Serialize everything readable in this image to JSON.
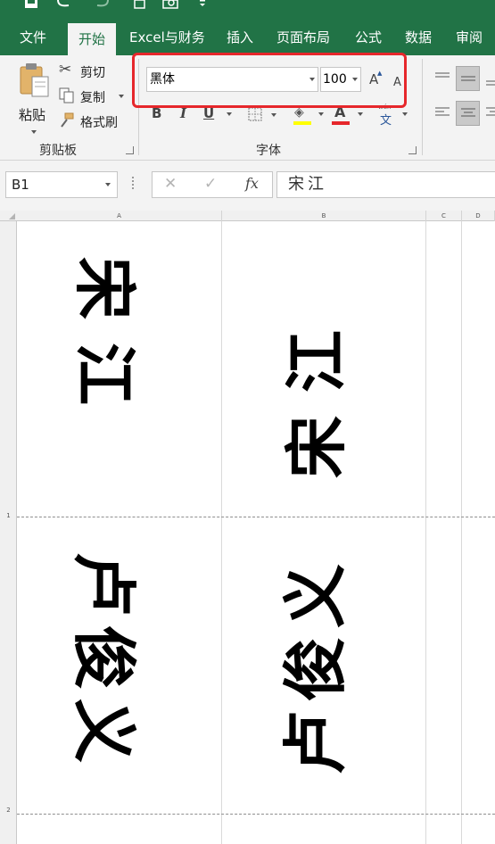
{
  "tabs": [
    "文件",
    "开始",
    "Excel与财务",
    "插入",
    "页面布局",
    "公式",
    "数据",
    "审阅"
  ],
  "active_tab": "开始",
  "clipboard": {
    "paste_label": "粘贴",
    "cut_label": "剪切",
    "copy_label": "复制",
    "format_painter_label": "格式刷",
    "group_label": "剪贴板"
  },
  "font": {
    "name": "黑体",
    "size": "100",
    "group_label": "字体",
    "grow_label": "A",
    "shrink_label": "A",
    "bold_label": "B",
    "italic_label": "I",
    "underline_label": "U",
    "font_color_label": "A",
    "phonetic_label": "文",
    "phonetic_top": "wén",
    "highlight_color": "#ffff00",
    "font_color": "#e6272b",
    "callout_color": "#e6272b"
  },
  "formula_bar": {
    "name_box": "B1",
    "cancel_icon": "✕",
    "enter_icon": "✓",
    "fx_label": "fx",
    "content": "宋江"
  },
  "sheet": {
    "columns": [
      "A",
      "B",
      "C",
      "D"
    ],
    "rows": [
      "1",
      "2"
    ],
    "cells": {
      "A1": "宋江",
      "B1": "宋江",
      "A2": "卢俊义",
      "B2": "卢俊义"
    }
  },
  "colors": {
    "ribbon_green": "#217346",
    "ribbon_bg": "#f3f3f3"
  }
}
